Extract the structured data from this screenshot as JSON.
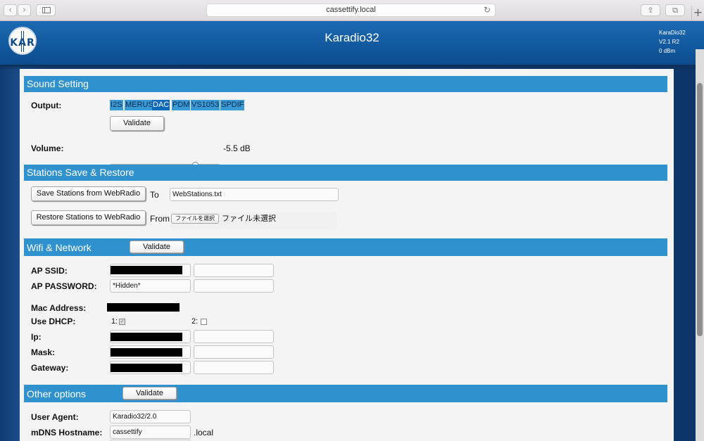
{
  "browser": {
    "url": "cassettify.local",
    "back_icon": "‹",
    "forward_icon": "›",
    "reload_icon": "↻",
    "share_icon": "⇪",
    "tabs_icon": "⧉",
    "newtab_icon": "+"
  },
  "header": {
    "title": "Karadio32",
    "logo_text": "KAR",
    "version_lines": [
      "KaraDio32",
      "V2.1 R2",
      "0 dBm"
    ]
  },
  "sound": {
    "title": "Sound Setting",
    "output_label": "Output:",
    "outputs": [
      "I2S",
      "MERUS",
      "DAC",
      "PDM",
      "VS1053",
      "SPDIF"
    ],
    "selected_output": "DAC",
    "validate": "Validate",
    "volume_label": "Volume:",
    "volume_value": "-5.5 dB",
    "volume_fraction": 0.78
  },
  "stations": {
    "title": "Stations Save & Restore",
    "save_button": "Save Stations from WebRadio",
    "to_label": "To",
    "filename": "WebStations.txt",
    "restore_button": "Restore Stations to WebRadio",
    "from_label": "From",
    "choose_file": "ファイルを選択",
    "no_file": "ファイル未選択"
  },
  "wifi": {
    "title": "Wifi & Network",
    "validate": "Validate",
    "ap_ssid_label": "AP SSID:",
    "ap_password_label": "AP PASSWORD:",
    "ap_password_value": "*Hidden*",
    "mac_label": "Mac Address:",
    "dhcp_label": "Use DHCP:",
    "dhcp1_label": "1:",
    "dhcp2_label": "2:",
    "ip_label": "Ip:",
    "mask_label": "Mask:",
    "gateway_label": "Gateway:"
  },
  "other": {
    "title": "Other options",
    "validate": "Validate",
    "user_agent_label": "User Agent:",
    "user_agent_value": "Karadio32/2.0",
    "mdns_label": "mDNS Hostname:",
    "mdns_value": "cassettify",
    "mdns_suffix": ".local"
  }
}
